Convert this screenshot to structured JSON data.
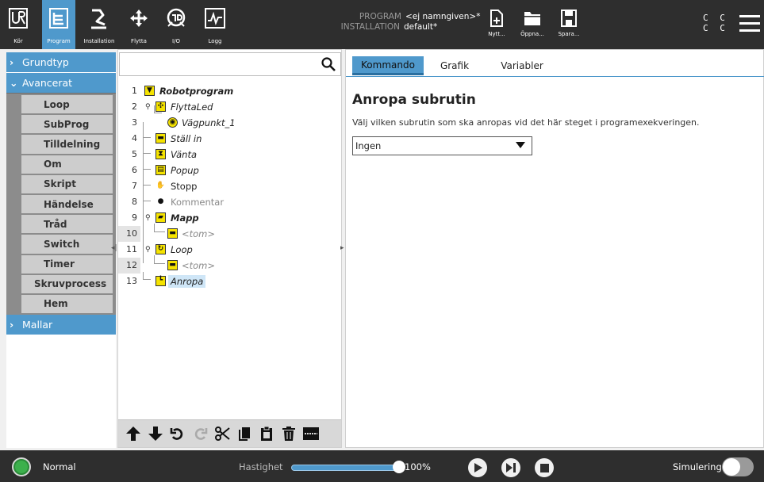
{
  "topbar": {
    "logo": "UR",
    "nav": [
      {
        "id": "kor",
        "label": "Kör",
        "icon": "ur-logo-icon"
      },
      {
        "id": "program",
        "label": "Program",
        "icon": "program-tree-icon",
        "active": true
      },
      {
        "id": "installation",
        "label": "Installation",
        "icon": "robot-arm-icon"
      },
      {
        "id": "flytta",
        "label": "Flytta",
        "icon": "move-arrows-icon"
      },
      {
        "id": "io",
        "label": "I/O",
        "icon": "io-icon"
      },
      {
        "id": "logg",
        "label": "Logg",
        "icon": "log-icon"
      }
    ],
    "program_key": "PROGRAM",
    "program_value": "<ej namngiven>*",
    "installation_key": "INSTALLATION",
    "installation_value": "default*",
    "file_buttons": [
      {
        "label": "Nytt...",
        "icon": "new-file-icon"
      },
      {
        "label": "Öppna...",
        "icon": "open-folder-icon"
      },
      {
        "label": "Spara...",
        "icon": "save-icon"
      }
    ],
    "cc": "C C\nC C",
    "menu_icon": "hamburger-menu-icon"
  },
  "leftnav": {
    "categories": [
      {
        "label": "Grundtyp",
        "expanded": false
      },
      {
        "label": "Avancerat",
        "expanded": true
      },
      {
        "label": "Mallar",
        "expanded": false
      }
    ],
    "advanced_items": [
      "Loop",
      "SubProg",
      "Tilldelning",
      "Om",
      "Skript",
      "Händelse",
      "Tråd",
      "Switch",
      "Timer",
      "Skruvprocess",
      "Hem"
    ],
    "collapse_handle": "◂|"
  },
  "tree": {
    "search_placeholder": "",
    "nodes": [
      {
        "num": "1",
        "label": "Robotprogram",
        "icon": "program-root-icon",
        "glyph": "▼",
        "style": "bold"
      },
      {
        "num": "2",
        "label": "FlyttaLed",
        "icon": "move-icon",
        "glyph": "✣",
        "style": "italic"
      },
      {
        "num": "3",
        "label": "Vägpunkt_1",
        "icon": "waypoint-icon",
        "glyph": "◉",
        "style": "italic"
      },
      {
        "num": "4",
        "label": "Ställ in",
        "icon": "set-icon",
        "glyph": "▬",
        "style": "italic"
      },
      {
        "num": "5",
        "label": "Vänta",
        "icon": "wait-hourglass-icon",
        "glyph": "⧗",
        "style": "italic"
      },
      {
        "num": "6",
        "label": "Popup",
        "icon": "popup-icon",
        "glyph": "▤",
        "style": "italic"
      },
      {
        "num": "7",
        "label": "Stopp",
        "icon": "stop-icon",
        "glyph": "✋",
        "style": "plain"
      },
      {
        "num": "8",
        "label": "Kommentar",
        "icon": "comment-icon",
        "glyph": "●",
        "style": "gray"
      },
      {
        "num": "9",
        "label": "Mapp",
        "icon": "folder-icon",
        "glyph": "▰",
        "style": "bold"
      },
      {
        "num": "10",
        "label": "<tom>",
        "icon": "empty-node-icon",
        "glyph": "▬",
        "style": "gray"
      },
      {
        "num": "11",
        "label": "Loop",
        "icon": "loop-icon",
        "glyph": "↻",
        "style": "italic"
      },
      {
        "num": "12",
        "label": "<tom>",
        "icon": "empty-node-icon",
        "glyph": "▬",
        "style": "gray"
      },
      {
        "num": "13",
        "label": "Anropa",
        "icon": "call-icon",
        "glyph": "┗",
        "style": "selected"
      }
    ],
    "toolbar": [
      {
        "name": "move-up-icon",
        "glyph": "🡅"
      },
      {
        "name": "move-down-icon",
        "glyph": "🡇"
      },
      {
        "name": "undo-icon",
        "glyph": "↶"
      },
      {
        "name": "redo-icon",
        "glyph": "↷"
      },
      {
        "name": "cut-icon",
        "glyph": "✂"
      },
      {
        "name": "copy-icon",
        "glyph": "▮"
      },
      {
        "name": "paste-icon",
        "glyph": "📋"
      },
      {
        "name": "delete-icon",
        "glyph": "🗑"
      },
      {
        "name": "suppress-icon",
        "glyph": "▬"
      }
    ]
  },
  "right": {
    "tabs": [
      "Kommando",
      "Grafik",
      "Variabler"
    ],
    "active_tab": "Kommando",
    "title": "Anropa subrutin",
    "description": "Välj vilken subrutin som ska anropas vid det här steget i programexekveringen.",
    "selected_subroutine": "Ingen"
  },
  "bottombar": {
    "status": "Normal",
    "status_color": "#3cb04c",
    "speed_label": "Hastighet",
    "speed_value": "100%",
    "speed_fraction": 1.0,
    "controls": [
      "play-icon",
      "step-icon",
      "stop-icon"
    ],
    "sim_label": "Simulering",
    "simulation_on": false
  },
  "colors": {
    "accent": "#4f99cc",
    "topbar": "#2e2e2e",
    "node_yellow": "#f5e300"
  }
}
